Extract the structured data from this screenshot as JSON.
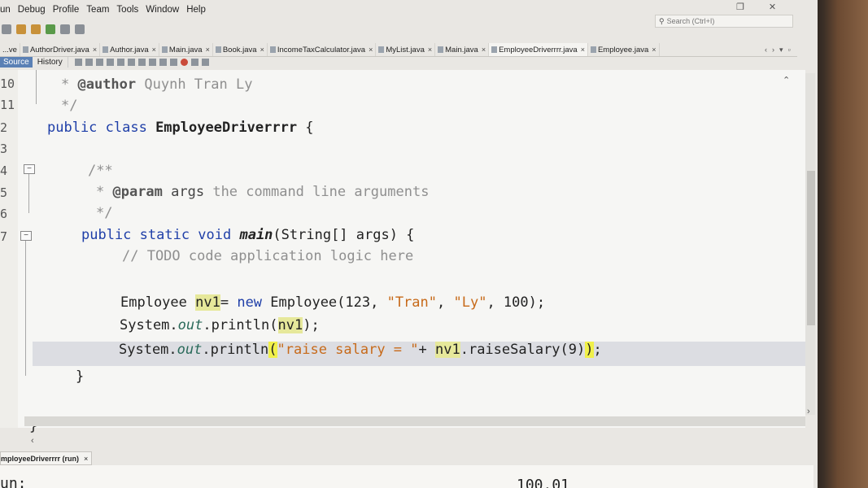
{
  "menu": [
    "un",
    "Debug",
    "Profile",
    "Team",
    "Tools",
    "Window",
    "Help"
  ],
  "search": {
    "placeholder": "Search (Ctrl+I)"
  },
  "tabs": [
    {
      "label": "...ve"
    },
    {
      "label": "AuthorDriver.java"
    },
    {
      "label": "Author.java"
    },
    {
      "label": "Main.java"
    },
    {
      "label": "Book.java"
    },
    {
      "label": "IncomeTaxCalculator.java"
    },
    {
      "label": "MyList.java"
    },
    {
      "label": "Main.java"
    },
    {
      "label": "EmployeeDriverrrr.java"
    },
    {
      "label": "Employee.java"
    }
  ],
  "editor_tabs": {
    "source": "Source",
    "history": "History"
  },
  "line_numbers": [
    "10",
    "11",
    "2",
    "3",
    "4",
    "5",
    "6",
    "7"
  ],
  "code": {
    "l1_star": "* ",
    "l1_tag": "@author",
    "l1_text": " Quynh Tran Ly",
    "l2": "*/",
    "l3_kw": "public class ",
    "l3_name": "EmployeeDriverrrr",
    "l3_rest": " {",
    "l5": "/**",
    "l6_star": "* ",
    "l6_tag": "@param",
    "l6_arg": " args",
    "l6_text": " the command line arguments",
    "l7": "*/",
    "l8_kw": "public static void ",
    "l8_name": "main",
    "l8_rest": "(String[] args) {",
    "l9": "// TODO code application logic here",
    "l11_type": "Employee ",
    "l11_var": "nv1",
    "l11_eq": "= ",
    "l11_new": "new",
    "l11_ctor": " Employee(123, ",
    "l11_s1": "\"Tran\"",
    "l11_c": ", ",
    "l11_s2": "\"Ly\"",
    "l11_end": ", 100);",
    "l12_sys": "System.",
    "l12_out": "out",
    "l12_print": ".println(",
    "l12_var": "nv1",
    "l12_end": ");",
    "l13_sys": "System.",
    "l13_out": "out",
    "l13_print": ".println",
    "l13_paren": "(",
    "l13_str": "\"raise salary = \"",
    "l13_plus": "+ ",
    "l13_var": "nv1",
    "l13_call": ".raiseSalary(9)",
    "l13_close": ")",
    "l13_semi": ";",
    "l14": "}",
    "l15": "}"
  },
  "output": {
    "tab_label": "mployeeDriverrrr (run)",
    "line1": "un:",
    "line2": "100.01"
  }
}
